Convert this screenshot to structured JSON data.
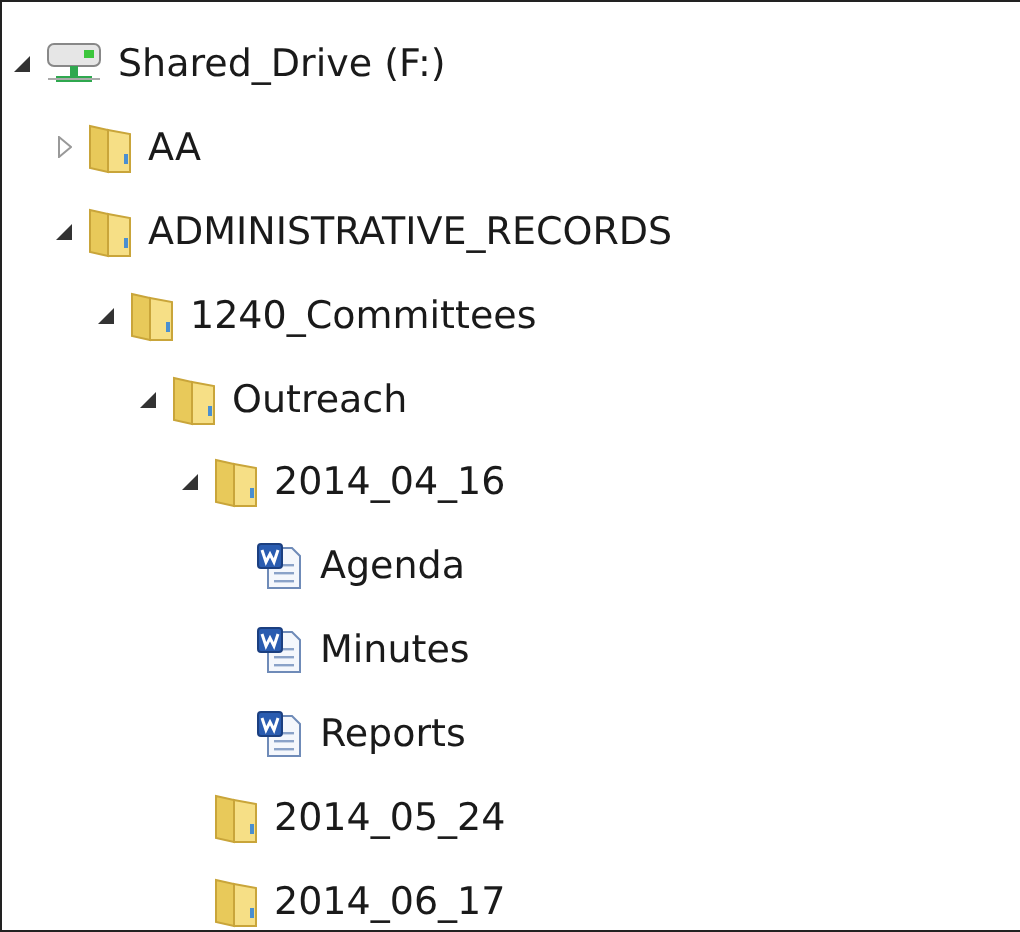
{
  "tree": [
    {
      "label": "Shared_Drive (F:)",
      "kind": "drive",
      "expanded": true,
      "children": [
        {
          "label": "AA",
          "kind": "folder",
          "expanded": false
        },
        {
          "label": "ADMINISTRATIVE_RECORDS",
          "kind": "folder",
          "expanded": true,
          "children": [
            {
              "label": "1240_Committees",
              "kind": "folder",
              "expanded": true,
              "children": [
                {
                  "label": "Outreach",
                  "kind": "folder",
                  "expanded": true,
                  "children": [
                    {
                      "label": "2014_04_16",
                      "kind": "folder",
                      "expanded": true,
                      "children": [
                        {
                          "label": "Agenda",
                          "kind": "document"
                        },
                        {
                          "label": "Minutes",
                          "kind": "document"
                        },
                        {
                          "label": "Reports",
                          "kind": "document"
                        }
                      ]
                    },
                    {
                      "label": "2014_05_24",
                      "kind": "folder"
                    },
                    {
                      "label": "2014_06_17",
                      "kind": "folder"
                    }
                  ]
                }
              ]
            }
          ]
        }
      ]
    }
  ]
}
